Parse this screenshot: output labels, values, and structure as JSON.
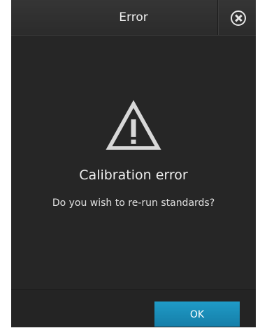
{
  "dialog": {
    "title": "Error",
    "heading": "Calibration error",
    "message": "Do you wish to re-run standards?",
    "ok_label": "OK",
    "close_icon": "close-circle-icon",
    "warning_icon": "warning-triangle-icon"
  },
  "colors": {
    "background": "#262626",
    "accent": "#1a8cba",
    "text": "#e8e8e8"
  }
}
